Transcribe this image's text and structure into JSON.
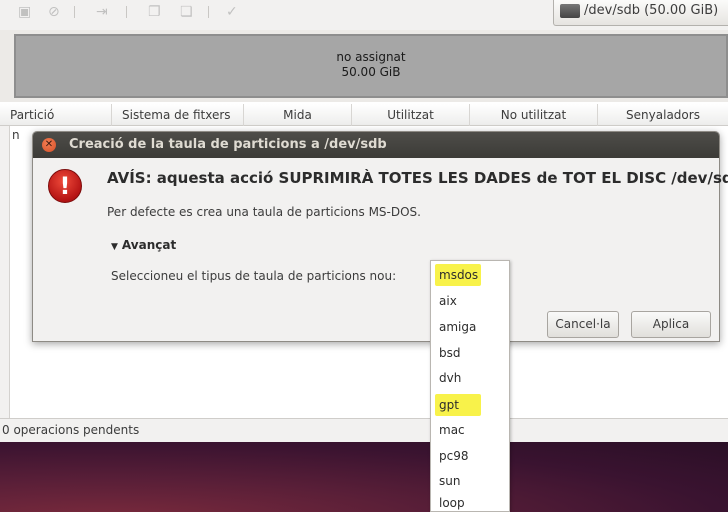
{
  "device_select": {
    "label": "/dev/sdb  (50.00 GiB)"
  },
  "disk_map": {
    "unallocated_label": "no assignat",
    "unallocated_size": "50.00 GiB"
  },
  "columns": [
    "Partició",
    "Sistema de fitxers",
    "Mida",
    "Utilitzat",
    "No utilitzat",
    "Senyaladors"
  ],
  "table": {
    "row_stub": "n"
  },
  "status_bar": {
    "text": "0 operacions pendents"
  },
  "dialog": {
    "title": "Creació de la taula de particions a /dev/sdb",
    "close_glyph": "✕",
    "warning_glyph": "!",
    "heading": "AVÍS: aquesta acció SUPRIMIRÀ TOTES LES DADES de TOT EL DISC /dev/sdb",
    "detail": "Per defecte es crea una taula de particions MS-DOS.",
    "advanced_arrow": "▼",
    "advanced_label": "Avançat",
    "select_label": "Seleccioneu el tipus de taula de particions nou:",
    "cancel_label": "Cancel·la",
    "apply_label": "Aplica"
  },
  "dropdown": {
    "options": [
      "msdos",
      "aix",
      "amiga",
      "bsd",
      "dvh",
      "gpt",
      "mac",
      "pc98",
      "sun",
      "loop"
    ],
    "highlighted": [
      "msdos",
      "gpt"
    ],
    "highlight_color": "#f8f24a"
  },
  "colors": {
    "titlebar": "#3c3b37",
    "close_button": "#d5512a",
    "warning": "#c41b1b",
    "unallocated": "#a6a6a6"
  }
}
